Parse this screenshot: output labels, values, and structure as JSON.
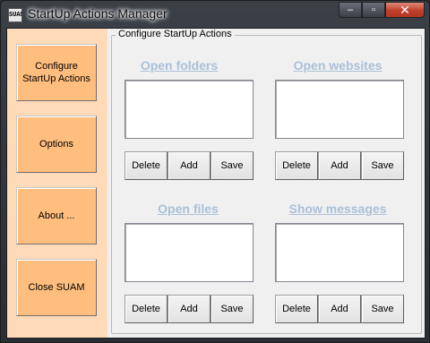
{
  "window": {
    "title": "StartUp Actions Manager",
    "icon_text": "SUAM"
  },
  "caption": {
    "minimize": "–",
    "maximize": "▫",
    "close": "✕"
  },
  "nav": [
    {
      "label": "Configure\nStartUp Actions"
    },
    {
      "label": "Options"
    },
    {
      "label": "About ..."
    },
    {
      "label": "Close SUAM"
    }
  ],
  "group": {
    "title": "Configure StartUp Actions"
  },
  "sections": {
    "folders": {
      "title": "Open folders"
    },
    "websites": {
      "title": "Open websites"
    },
    "files": {
      "title": "Open files"
    },
    "messages": {
      "title": "Show messages"
    }
  },
  "buttons": {
    "delete": "Delete",
    "add": "Add",
    "save": "Save"
  },
  "colors": {
    "nav_bg": "#ffdab9",
    "nav_button": "#ffbe7d",
    "section_link": "#a9c0d9"
  }
}
